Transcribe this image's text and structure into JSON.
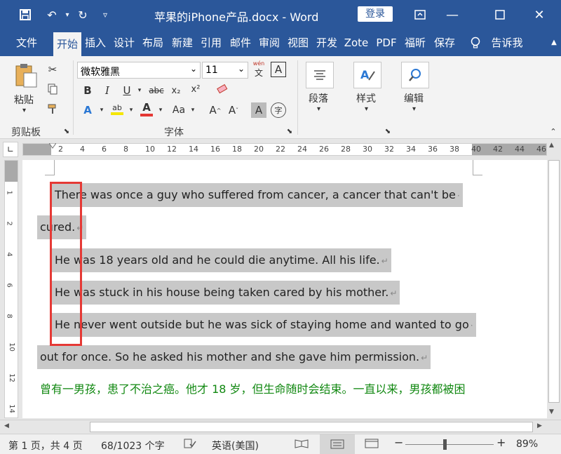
{
  "title_bar": {
    "doc_title": "苹果的iPhone产品.docx  -  Word",
    "login": "登录"
  },
  "tabs": [
    "文件",
    "开始",
    "插入",
    "设计",
    "布局",
    "新建",
    "引用",
    "邮件",
    "审阅",
    "视图",
    "开发",
    "Zote",
    "PDF",
    "福昕",
    "保存",
    "告诉我"
  ],
  "ribbon": {
    "paste": "粘贴",
    "clipboard": "剪贴板",
    "font_name": "微软雅黑",
    "font_size": "11",
    "font_group": "字体",
    "paragraph": "段落",
    "styles": "样式",
    "editing": "编辑",
    "bold": "B",
    "italic": "I",
    "underline": "U",
    "strike": "abc",
    "sub": "x₂",
    "sup": "x²",
    "wen": "wén",
    "aa": "Aa"
  },
  "ruler_ticks": [
    "2",
    "4",
    "6",
    "8",
    "10",
    "12",
    "14",
    "16",
    "18",
    "20",
    "22",
    "24",
    "26",
    "28",
    "30",
    "32",
    "34",
    "36",
    "38",
    "40",
    "42",
    "44",
    "46"
  ],
  "vruler_ticks": [
    "1",
    "2",
    "4",
    "6",
    "8",
    "10",
    "12",
    "14"
  ],
  "document": {
    "lines": [
      "There was once a guy who suffered from cancer, a cancer that can't be",
      "cured.",
      "He was 18 years old and he could die anytime. All his life.",
      "He was stuck in his house being taken cared by his mother.",
      "He never went outside but he was sick of staying home and wanted to go",
      "out for once. So he asked his mother and she gave him permission.",
      "曾有一男孩，患了不治之癌。他才 18 岁，但生命随时会结束。一直以来，男孩都被困"
    ]
  },
  "status": {
    "page": "第 1 页，共 4 页",
    "words": "68/1023 个字",
    "language": "英语(美国)",
    "zoom": "89%"
  },
  "colors": {
    "brand": "#2b579a",
    "selection": "#c8c8c8",
    "highlight_box": "#e53935",
    "chinese_text": "#118811"
  }
}
